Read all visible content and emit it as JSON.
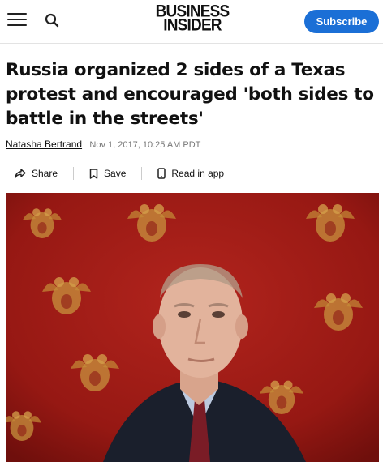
{
  "header": {
    "logo_line1": "BUSINESS",
    "logo_line2": "INSIDER",
    "subscribe_label": "Subscribe",
    "menu_icon": "hamburger-icon",
    "search_icon": "search-icon",
    "accent_color": "#1b6fd6"
  },
  "article": {
    "title": "Russia organized 2 sides of a Texas protest and encouraged 'both sides to battle in the streets'",
    "author": "Natasha Bertrand",
    "date": "Nov 1, 2017, 10:25 AM PDT"
  },
  "actions": {
    "share_label": "Share",
    "save_label": "Save",
    "read_in_app_label": "Read in app"
  },
  "hero": {
    "background_color": "#9e1a17"
  }
}
